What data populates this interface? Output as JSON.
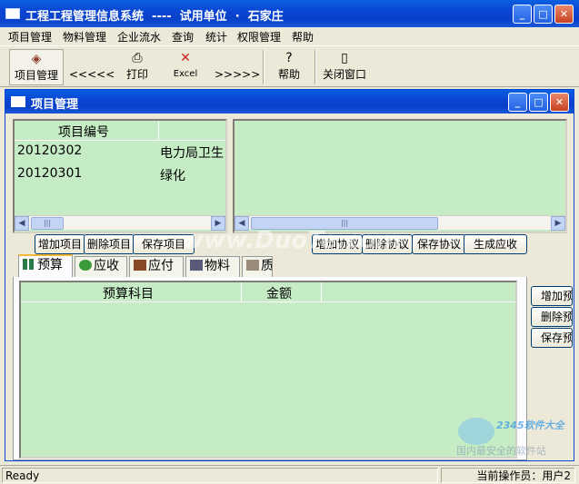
{
  "window": {
    "title": "工程工程管理信息系统  ----  试用单位  ·  石家庄",
    "minimize_glyph": "_",
    "maximize_glyph": "□",
    "close_glyph": "✕"
  },
  "menu": [
    "项目管理",
    "物料管理",
    "企业流水",
    "查询",
    "统计",
    "权限管理",
    "帮助"
  ],
  "toolbar": {
    "project": {
      "label": "项目管理",
      "icon": "book-icon"
    },
    "prev": {
      "label": "<<<<<"
    },
    "print": {
      "label": "打印",
      "icon": "printer-icon"
    },
    "excel": {
      "label": "Excel",
      "icon": "excel-icon"
    },
    "next": {
      "label": ">>>>>"
    },
    "help": {
      "label": "帮助",
      "icon": "help-icon"
    },
    "close_window": {
      "label": "关闭窗口",
      "icon": "exit-door-icon"
    }
  },
  "child_window": {
    "title": "项目管理",
    "project_grid": {
      "header": "项目编号",
      "rows": [
        {
          "code": "20120302",
          "name": "电力局卫生"
        },
        {
          "code": "20120301",
          "name": "绿化"
        }
      ]
    },
    "project_buttons": [
      "增加项目",
      "删除项目",
      "保存项目"
    ],
    "protocol_buttons": [
      "增加协议",
      "删除协议",
      "保存协议",
      "生成应收"
    ],
    "tabs": [
      "预算",
      "应收",
      "应付",
      "物料",
      "质"
    ],
    "budget_grid": {
      "columns": [
        "预算科目",
        "金额"
      ]
    },
    "budget_buttons": [
      "增加预",
      "删除预",
      "保存预"
    ]
  },
  "status": {
    "left": "Ready",
    "right": "当前操作员：用户2"
  },
  "watermark": {
    "center": "www.DuoTe.com",
    "logo_top": "2345软件大全",
    "logo_bottom": "国内最安全的软件站"
  },
  "colors": {
    "title_blue": "#0a46d4",
    "grid_green": "#c6ecc6",
    "face": "#ece9d8"
  }
}
